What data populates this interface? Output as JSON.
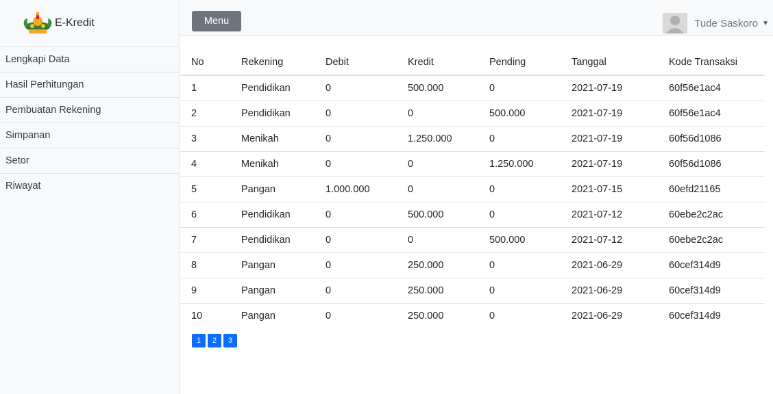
{
  "brand": {
    "name": "E-Kredit"
  },
  "sidebar": {
    "items": [
      {
        "label": "Lengkapi Data"
      },
      {
        "label": "Hasil Perhitungan"
      },
      {
        "label": "Pembuatan Rekening"
      },
      {
        "label": "Simpanan"
      },
      {
        "label": "Setor"
      },
      {
        "label": "Riwayat"
      }
    ]
  },
  "topbar": {
    "menu_label": "Menu",
    "user_name": "Tude Saskoro",
    "caret": "▼"
  },
  "table": {
    "headers": [
      "No",
      "Rekening",
      "Debit",
      "Kredit",
      "Pending",
      "Tanggal",
      "Kode Transaksi"
    ],
    "rows": [
      [
        "1",
        "Pendidikan",
        "0",
        "500.000",
        "0",
        "2021-07-19",
        "60f56e1ac4"
      ],
      [
        "2",
        "Pendidikan",
        "0",
        "0",
        "500.000",
        "2021-07-19",
        "60f56e1ac4"
      ],
      [
        "3",
        "Menikah",
        "0",
        "1.250.000",
        "0",
        "2021-07-19",
        "60f56d1086"
      ],
      [
        "4",
        "Menikah",
        "0",
        "0",
        "1.250.000",
        "2021-07-19",
        "60f56d1086"
      ],
      [
        "5",
        "Pangan",
        "1.000.000",
        "0",
        "0",
        "2021-07-15",
        "60efd21165"
      ],
      [
        "6",
        "Pendidikan",
        "0",
        "500.000",
        "0",
        "2021-07-12",
        "60ebe2c2ac"
      ],
      [
        "7",
        "Pendidikan",
        "0",
        "0",
        "500.000",
        "2021-07-12",
        "60ebe2c2ac"
      ],
      [
        "8",
        "Pangan",
        "0",
        "250.000",
        "0",
        "2021-06-29",
        "60cef314d9"
      ],
      [
        "9",
        "Pangan",
        "0",
        "250.000",
        "0",
        "2021-06-29",
        "60cef314d9"
      ],
      [
        "10",
        "Pangan",
        "0",
        "250.000",
        "0",
        "2021-06-29",
        "60cef314d9"
      ]
    ]
  },
  "pagination": {
    "pages": [
      "1",
      "2",
      "3"
    ]
  },
  "colors": {
    "sidebar_bg": "#f8f9fa",
    "menu_button": "#6c757d",
    "page_button": "#0d6efd",
    "border": "#dee2e6"
  },
  "icons": {
    "logo": "ornamental-crest-logo",
    "avatar": "user-avatar-icon",
    "caret": "caret-down-icon"
  }
}
